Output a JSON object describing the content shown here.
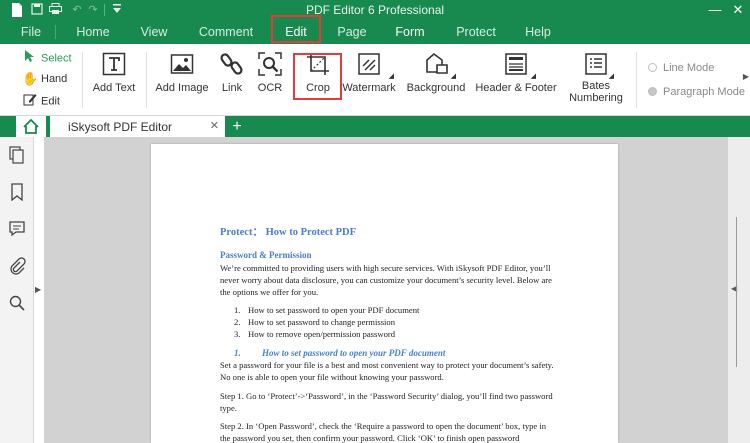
{
  "app": {
    "title": "PDF Editor 6 Professional"
  },
  "menu": {
    "items": [
      {
        "label": "File"
      },
      {
        "label": "Home"
      },
      {
        "label": "View"
      },
      {
        "label": "Comment"
      },
      {
        "label": "Edit"
      },
      {
        "label": "Page"
      },
      {
        "label": "Form"
      },
      {
        "label": "Protect"
      },
      {
        "label": "Help"
      }
    ],
    "active": "Edit"
  },
  "ribbon": {
    "select_tools": {
      "select": "Select",
      "hand": "Hand",
      "edit": "Edit"
    },
    "buttons": {
      "add_text": "Add Text",
      "add_image": "Add Image",
      "link": "Link",
      "ocr": "OCR",
      "crop": "Crop",
      "watermark": "Watermark",
      "background": "Background",
      "header_footer": "Header & Footer",
      "bates_numbering_line1": "Bates",
      "bates_numbering_line2": "Numbering"
    },
    "modes": {
      "line": "Line Mode",
      "paragraph": "Paragraph Mode"
    }
  },
  "tabs": {
    "document": "iSkysoft PDF Editor"
  },
  "document": {
    "title": "Protect： How to Protect PDF",
    "section": "Password & Permission",
    "intro": "We’re committed to providing users with high secure services. With iSkysoft PDF Editor, you’ll never worry about data disclosure, you can customize your document’s security level. Below are the options we offer for you.",
    "list": [
      {
        "num": "1.",
        "text": "How to set password to open your PDF document"
      },
      {
        "num": "2.",
        "text": "How to set password to change permission"
      },
      {
        "num": "3.",
        "text": "How to remove open/permission password"
      }
    ],
    "subhead_num": "1.",
    "subhead": "How to set password to open your PDF document",
    "para1": "Set a password for your file is a best and most convenient way to protect your document’s safety. No one is able to open your file without knowing your password.",
    "step1": "Step 1. Go to ‘Protect’->‘Password’, in the ‘Password Security’ dialog, you’ll find two password type.",
    "step2": "Step 2. In ‘Open Password’, check the ‘Require a password to open the document’ box, type in the password you set, then confirm your password. Click ‘OK’ to finish open password"
  },
  "icons": {
    "save": "save-icon",
    "print": "print-icon",
    "undo": "undo-icon",
    "redo": "redo-icon",
    "quick_access": "quick-access-icon",
    "minimize": "minimize-icon",
    "close": "close-icon"
  },
  "colors": {
    "accent": "#188a4f",
    "highlight": "#e43c3c",
    "heading": "#4a7ec7"
  }
}
